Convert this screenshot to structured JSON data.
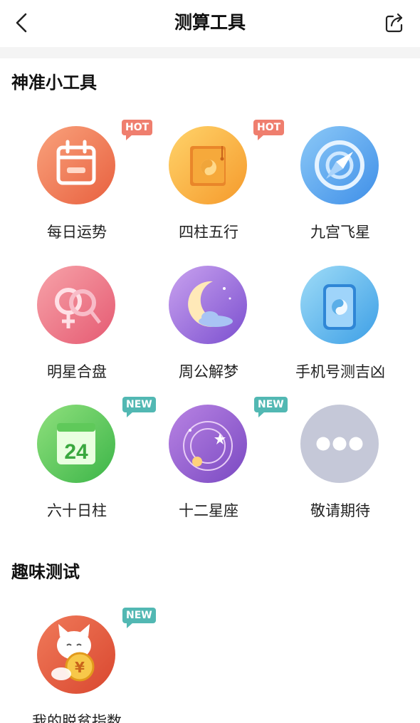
{
  "nav": {
    "title": "测算工具"
  },
  "sections": [
    {
      "title": "神准小工具",
      "items": [
        {
          "label": "每日运势",
          "badge": "HOT",
          "icon": "calendar-icon"
        },
        {
          "label": "四柱五行",
          "badge": "HOT",
          "icon": "book-icon"
        },
        {
          "label": "九宫飞星",
          "badge": "",
          "icon": "compass-icon"
        },
        {
          "label": "明星合盘",
          "badge": "",
          "icon": "couple-icon"
        },
        {
          "label": "周公解梦",
          "badge": "",
          "icon": "moon-icon"
        },
        {
          "label": "手机号测吉凶",
          "badge": "",
          "icon": "phone-icon"
        },
        {
          "label": "六十日柱",
          "badge": "NEW",
          "icon": "calendar-24-icon"
        },
        {
          "label": "十二星座",
          "badge": "NEW",
          "icon": "zodiac-icon"
        },
        {
          "label": "敬请期待",
          "badge": "",
          "icon": "more-icon"
        }
      ]
    },
    {
      "title": "趣味测试",
      "items": [
        {
          "label": "我的脱贫指数",
          "badge": "NEW",
          "icon": "lucky-cat-icon"
        }
      ]
    }
  ],
  "colors": {
    "hot_badge": "#ef7e6e",
    "new_badge": "#52b8b3",
    "more_circle": "#c5c8d8"
  }
}
